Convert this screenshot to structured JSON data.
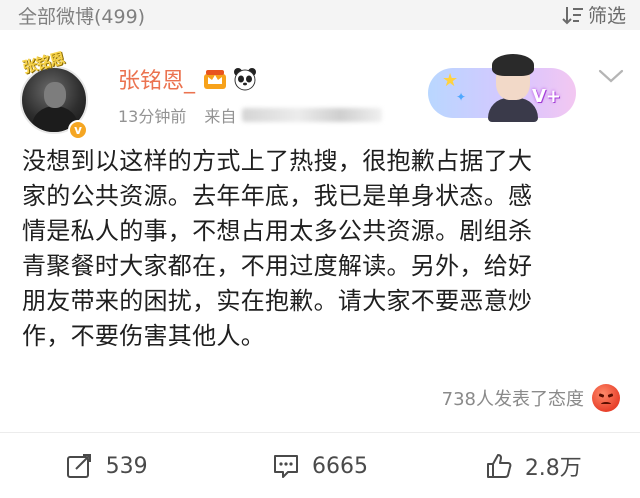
{
  "header": {
    "count_label": "全部微博(499)",
    "filter_label": "筛选",
    "filter_icon": "sort-filter-icon"
  },
  "post": {
    "username": "张铭恩_",
    "avatar_sticker": "张铭恩",
    "badges": [
      "crown-icon",
      "panda-icon"
    ],
    "verified_mark": "v",
    "time": "13分钟前",
    "source_prefix": "来自",
    "content": "没想到以这样的方式上了热搜，很抱歉占据了大\n家的公共资源。去年年底，我已是单身状态。感\n情是私人的事，不想占用太多公共资源。剧组杀\n青聚餐时大家都在，不用过度解读。另外，给好\n朋友带来的困扰，实在抱歉。请大家不要恶意炒\n作，不要伤害其他人。",
    "promo_badge": "V+",
    "attitude_text": "738人发表了态度",
    "attitude_emoji": "angry-face-icon"
  },
  "actions": {
    "repost_count": "539",
    "comment_count": "6665",
    "like_count": "2.8万"
  },
  "colors": {
    "username": "#eb7350",
    "meta": "#939393",
    "topbar_bg": "#f4f4f4",
    "verify_badge": "#f5a623"
  }
}
